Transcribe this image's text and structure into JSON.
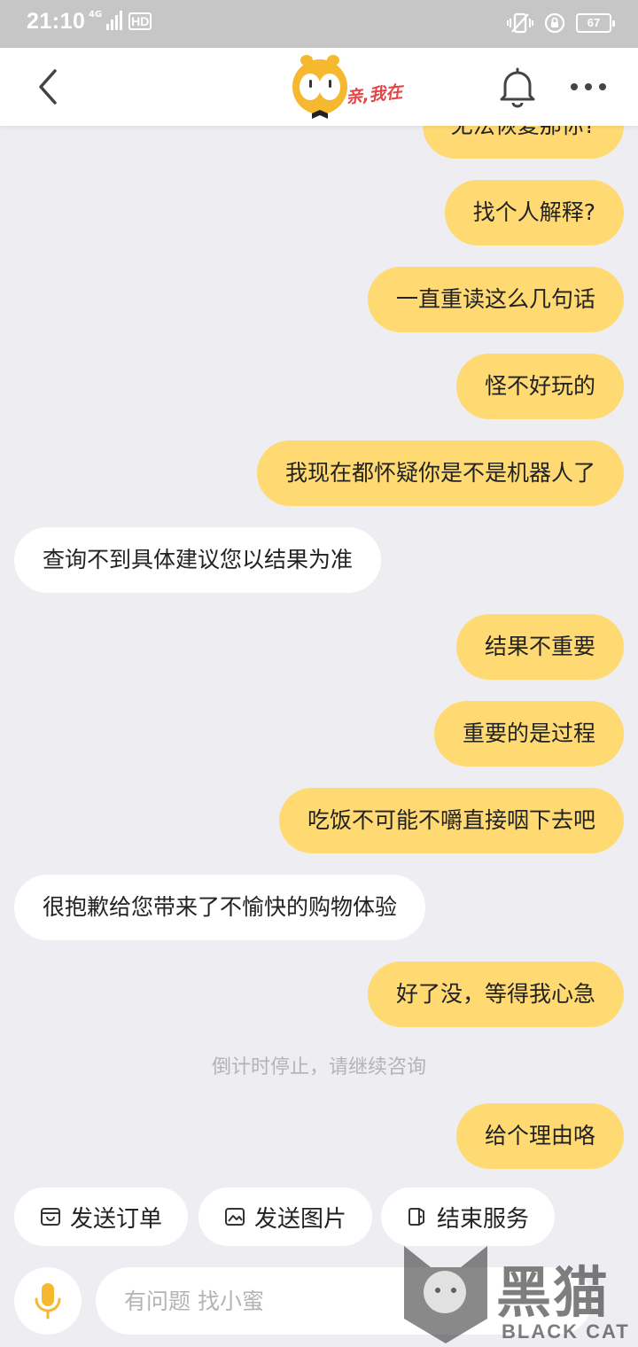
{
  "status_bar": {
    "time": "21:10",
    "network": "4G",
    "hd": "HD",
    "battery": "67"
  },
  "header": {
    "logo_text": "亲,我在",
    "icons": [
      "back-icon",
      "bell-icon",
      "more-icon"
    ]
  },
  "messages": [
    {
      "side": "out",
      "text": "无法恢复那你?"
    },
    {
      "side": "out",
      "text": "找个人解释?"
    },
    {
      "side": "out",
      "text": "一直重读这么几句话"
    },
    {
      "side": "out",
      "text": "怪不好玩的"
    },
    {
      "side": "out",
      "text": "我现在都怀疑你是不是机器人了"
    },
    {
      "side": "in",
      "text": "查询不到具体建议您以结果为准"
    },
    {
      "side": "out",
      "text": "结果不重要"
    },
    {
      "side": "out",
      "text": "重要的是过程"
    },
    {
      "side": "out",
      "text": "吃饭不可能不嚼直接咽下去吧"
    },
    {
      "side": "in",
      "text": "很抱歉给您带来了不愉快的购物体验"
    },
    {
      "side": "out",
      "text": "好了没，等得我心急"
    },
    {
      "side": "system",
      "text": "倒计时停止，请继续咨询"
    },
    {
      "side": "out",
      "text": "给个理由咯"
    }
  ],
  "quick_actions": {
    "send_order": "发送订单",
    "send_image": "发送图片",
    "end_service": "结束服务"
  },
  "input": {
    "placeholder": "有问题 找小蜜",
    "value": ""
  },
  "watermark": {
    "title": "黑猫",
    "subtitle": "BLACK CAT"
  },
  "colors": {
    "outgoing_bubble": "#ffda73",
    "incoming_bubble": "#ffffff",
    "background": "#ededf2",
    "accent": "#f5b82e"
  }
}
